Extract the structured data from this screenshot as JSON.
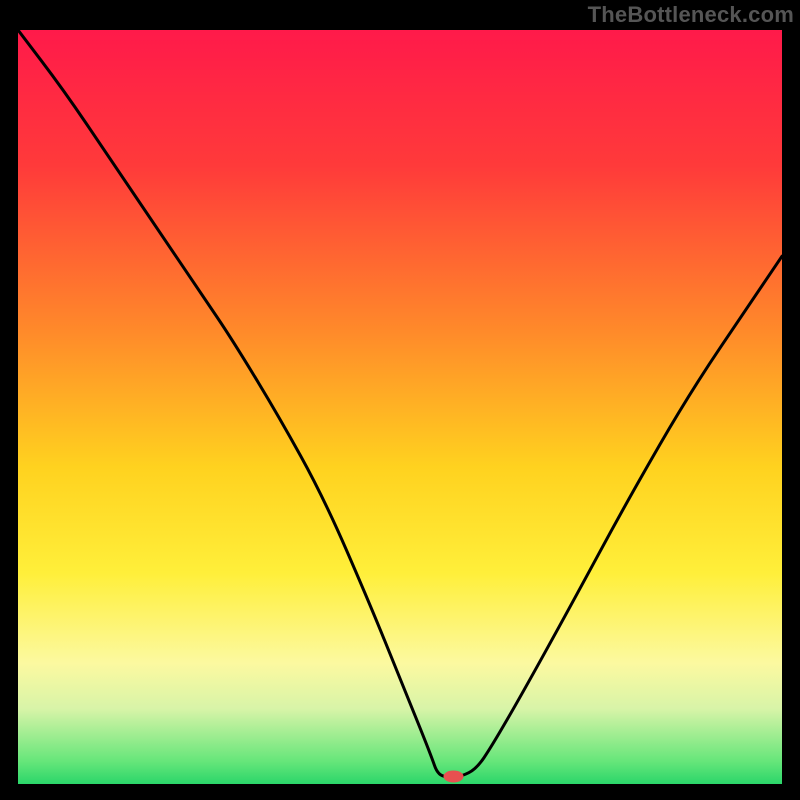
{
  "watermark": "TheBottleneck.com",
  "chart_data": {
    "type": "line",
    "title": "",
    "xlabel": "",
    "ylabel": "",
    "xlim": [
      0,
      100
    ],
    "ylim": [
      0,
      100
    ],
    "background_gradient": {
      "stops": [
        {
          "offset": 0,
          "color": "#ff1a4a"
        },
        {
          "offset": 18,
          "color": "#ff3a3a"
        },
        {
          "offset": 40,
          "color": "#ff8a2a"
        },
        {
          "offset": 58,
          "color": "#ffd21f"
        },
        {
          "offset": 72,
          "color": "#ffef3a"
        },
        {
          "offset": 84,
          "color": "#fcf9a0"
        },
        {
          "offset": 90,
          "color": "#d8f4a8"
        },
        {
          "offset": 97,
          "color": "#66e67a"
        },
        {
          "offset": 100,
          "color": "#2bd66a"
        }
      ]
    },
    "series": [
      {
        "name": "bottleneck-curve",
        "color": "#000000",
        "x": [
          0,
          6,
          12,
          18,
          24,
          28,
          34,
          40,
          46,
          50,
          54,
          55,
          57,
          58,
          60,
          62,
          66,
          72,
          80,
          88,
          96,
          100
        ],
        "y": [
          100,
          92,
          83,
          74,
          65,
          59,
          49,
          38,
          24,
          14,
          4,
          1,
          1,
          1,
          2,
          5,
          12,
          23,
          38,
          52,
          64,
          70
        ]
      }
    ],
    "marker": {
      "name": "optimal-point",
      "x": 57,
      "y": 1,
      "color": "#e85050",
      "rx": 10,
      "ry": 6
    }
  }
}
